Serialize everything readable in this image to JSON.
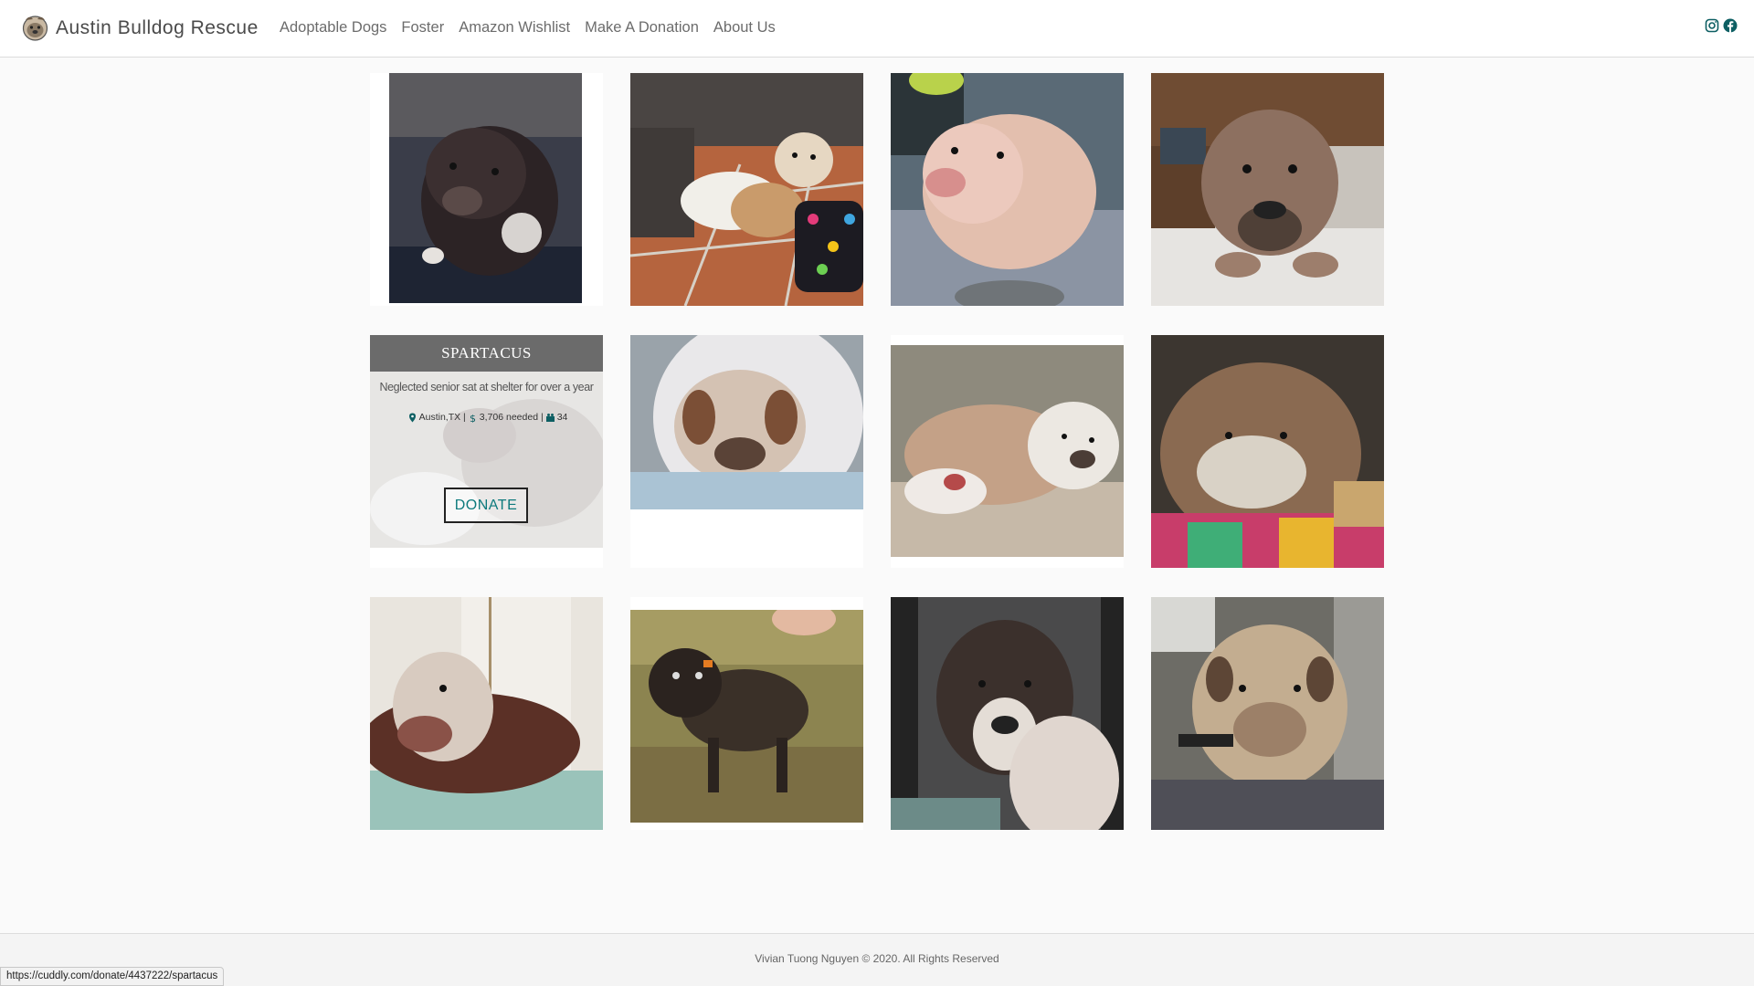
{
  "brand": {
    "name": "Austin Bulldog Rescue",
    "logo": "bulldog-logo-icon"
  },
  "nav": {
    "links": [
      "Adoptable Dogs",
      "Foster",
      "Amazon Wishlist",
      "Make A Donation",
      "About Us"
    ]
  },
  "social": {
    "instagram": "instagram-icon",
    "facebook": "facebook-icon",
    "color": "#0d5f63"
  },
  "hovered_card": {
    "name": "SPARTACUS",
    "description": "Neglected senior sat at shelter for over a year",
    "location": "Austin,TX",
    "amount": "3,706 needed",
    "donors": "34",
    "donate_label": "DONATE"
  },
  "footer": {
    "text": "Vivian Tuong Nguyen © 2020. All Rights Reserved"
  },
  "status_bar": {
    "url": "https://cuddly.com/donate/4437222/spartacus"
  },
  "colors": {
    "accent": "#0d7a7d",
    "overlay_header": "#6b6b6b"
  }
}
